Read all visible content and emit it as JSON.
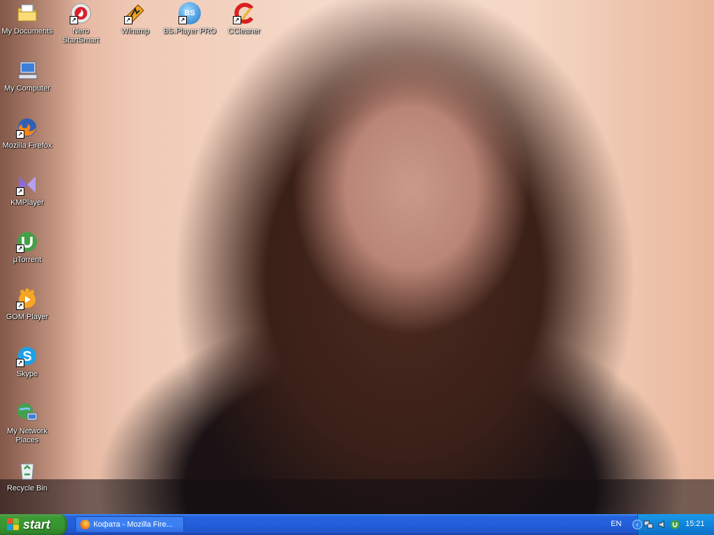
{
  "desktop": {
    "icons": [
      {
        "label": "My Documents",
        "icon": "my-documents-icon"
      },
      {
        "label": "Nero\nStartSmart",
        "icon": "nero-icon"
      },
      {
        "label": "Winamp",
        "icon": "winamp-icon"
      },
      {
        "label": "BS.Player PRO",
        "icon": "bsplayer-icon"
      },
      {
        "label": "CCleaner",
        "icon": "ccleaner-icon"
      },
      {
        "label": "My Computer",
        "icon": "my-computer-icon"
      },
      {
        "label": "Mozilla Firefox",
        "icon": "firefox-icon"
      },
      {
        "label": "KMPlayer",
        "icon": "kmplayer-icon"
      },
      {
        "label": "µTorrent",
        "icon": "utorrent-icon"
      },
      {
        "label": "GOM Player",
        "icon": "gom-player-icon"
      },
      {
        "label": "Skype",
        "icon": "skype-icon"
      },
      {
        "label": "My Network Places",
        "icon": "network-places-icon"
      },
      {
        "label": "Recycle Bin",
        "icon": "recycle-bin-icon"
      }
    ],
    "glyphs": {
      "bsplayer": "BS"
    }
  },
  "taskbar": {
    "start_label": "start",
    "task_buttons": [
      {
        "label": "Кофата - Mozilla Fire...",
        "icon": "firefox-icon"
      }
    ],
    "language": "EN",
    "tray_icons": [
      "show-hidden-icon",
      "network-icon",
      "volume-icon",
      "utorrent-tray-icon"
    ],
    "clock": "15:21"
  },
  "colors": {
    "taskbar_blue": "#245edb",
    "start_green": "#3c9a34",
    "tray_blue": "#0f84dc"
  }
}
